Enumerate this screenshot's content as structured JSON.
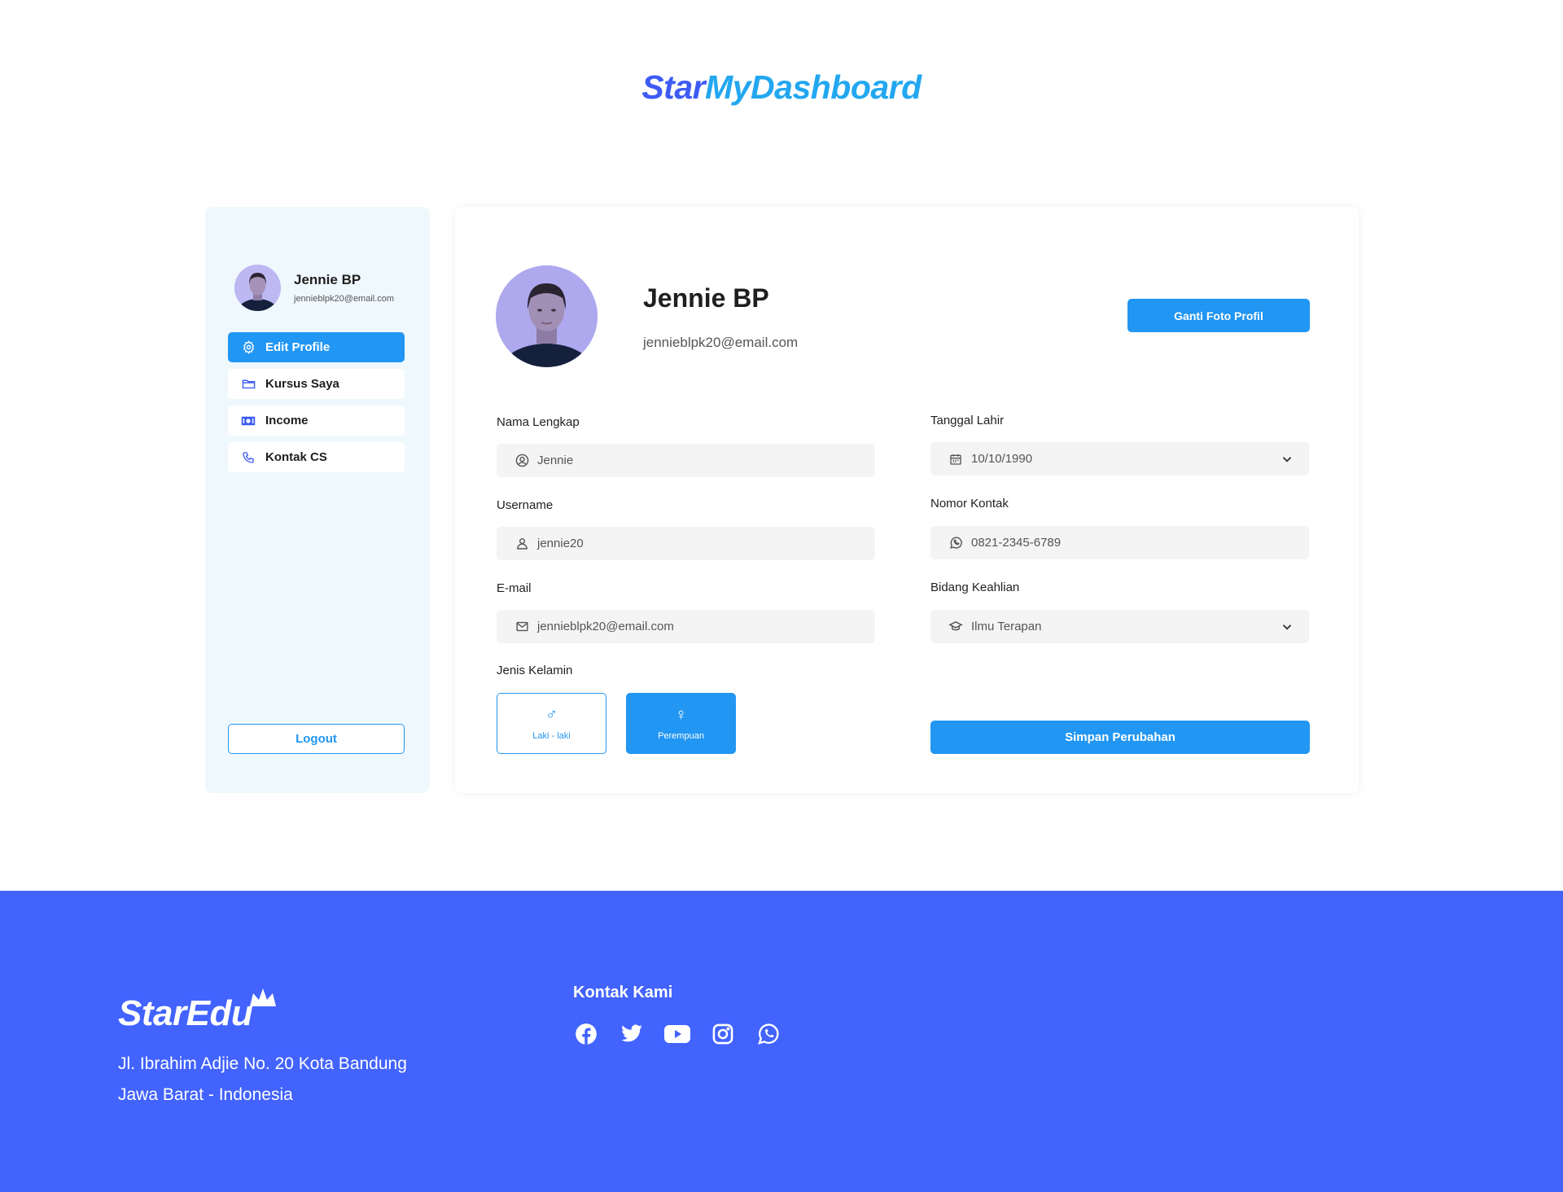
{
  "brand": {
    "part1": "Star",
    "part2": "MyDashboard"
  },
  "sidebar": {
    "user": {
      "name": "Jennie BP",
      "email": "jennieblpk20@email.com"
    },
    "items": [
      {
        "label": "Edit Profile",
        "icon": "gear-icon",
        "active": true
      },
      {
        "label": "Kursus Saya",
        "icon": "folder-icon",
        "active": false
      },
      {
        "label": "Income",
        "icon": "money-icon",
        "active": false
      },
      {
        "label": "Kontak CS",
        "icon": "phone-icon",
        "active": false
      }
    ],
    "logout_label": "Logout"
  },
  "profile": {
    "name": "Jennie BP",
    "email": "jennieblpk20@email.com",
    "change_photo_label": "Ganti Foto Profil"
  },
  "form": {
    "full_name": {
      "label": "Nama Lengkap",
      "value": "Jennie"
    },
    "username": {
      "label": "Username",
      "value": "jennie20"
    },
    "email": {
      "label": "E-mail",
      "value": "jennieblpk20@email.com"
    },
    "birth_date": {
      "label": "Tanggal Lahir",
      "value": "10/10/1990"
    },
    "phone": {
      "label": "Nomor Kontak",
      "value": "0821-2345-6789"
    },
    "expertise": {
      "label": "Bidang Keahlian",
      "value": "Ilmu Terapan"
    },
    "gender": {
      "label": "Jenis Kelamin",
      "male": "Laki - laki",
      "female": "Perempuan",
      "selected": "Perempuan"
    },
    "save_label": "Simpan Perubahan"
  },
  "footer": {
    "logo_text": "StarEdu",
    "address_line1": "Jl. Ibrahim Adjie No. 20 Kota Bandung",
    "address_line2": "Jawa Barat - Indonesia",
    "contact_title": "Kontak Kami",
    "socials": [
      "facebook-icon",
      "twitter-icon",
      "youtube-icon",
      "instagram-icon",
      "whatsapp-icon"
    ]
  },
  "colors": {
    "primary": "#2196f3",
    "brand_blue": "#3d5bf5",
    "brand_sky": "#22a7f0",
    "footer_bg": "#4263fe",
    "sidebar_bg": "#eff8fd"
  }
}
